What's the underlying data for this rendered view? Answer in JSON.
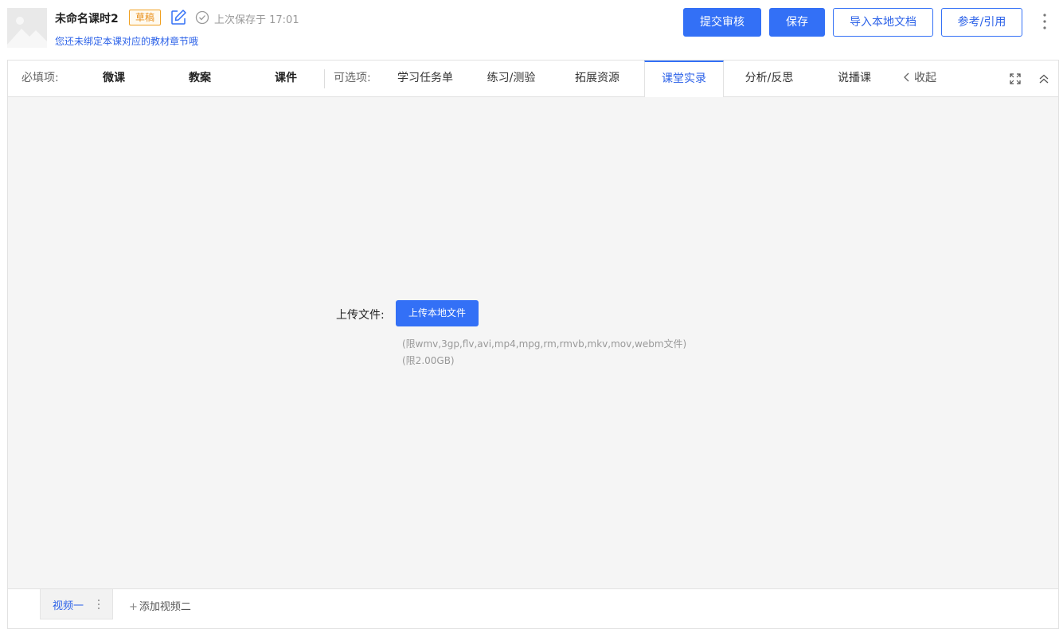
{
  "header": {
    "title": "未命名课时2",
    "status_badge": "草稿",
    "saved_text": "上次保存于 17:01",
    "bind_hint": "您还未绑定本课对应的教材章节哦",
    "buttons": {
      "submit": "提交审核",
      "save": "保存",
      "import": "导入本地文档",
      "reference": "参考/引用"
    }
  },
  "tabs": {
    "required_label": "必填项:",
    "required": [
      "微课",
      "教案",
      "课件"
    ],
    "optional_label": "可选项:",
    "optional": [
      "学习任务单",
      "练习/测验",
      "拓展资源",
      "课堂实录",
      "分析/反思",
      "说播课"
    ],
    "active": "课堂实录",
    "collapse": "收起"
  },
  "upload": {
    "label": "上传文件:",
    "button": "上传本地文件",
    "formats_hint": "(限wmv,3gp,flv,avi,mp4,mpg,rm,rmvb,mkv,mov,webm文件)",
    "size_hint": "(限2.00GB)"
  },
  "videos": {
    "current": "视频一",
    "add": "添加视频二"
  },
  "colors": {
    "accent": "#3370f6",
    "link": "#2c62e8",
    "badge": "#e8901c",
    "content_bg": "#f5f5f5"
  },
  "icons": [
    "image-placeholder-icon",
    "edit-icon",
    "check-circle-icon",
    "more-vertical-icon",
    "chevron-left-icon",
    "fullscreen-icon",
    "chevron-up-icon",
    "plus-icon"
  ]
}
